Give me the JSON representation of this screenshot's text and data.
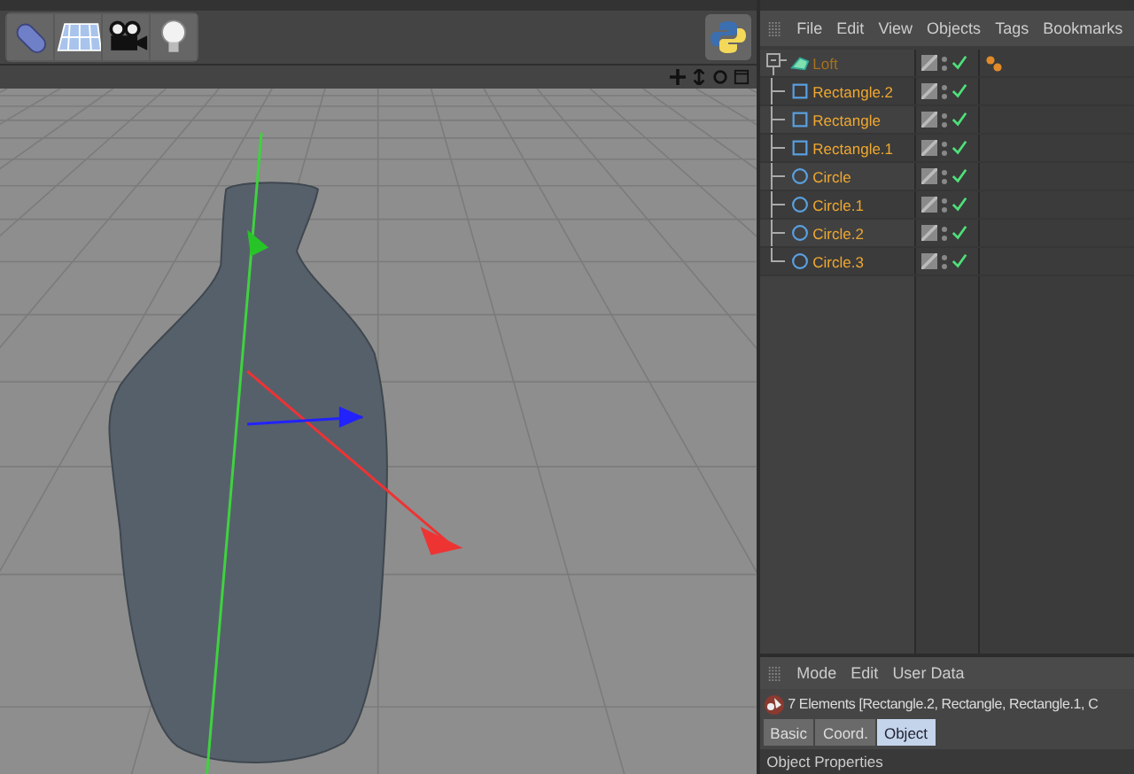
{
  "toolbar": {
    "tools": [
      {
        "kind": "capsule"
      },
      {
        "kind": "plane"
      },
      {
        "kind": "camera"
      },
      {
        "kind": "light"
      }
    ]
  },
  "object_manager": {
    "menu": [
      "File",
      "Edit",
      "View",
      "Objects",
      "Tags",
      "Bookmarks"
    ],
    "objects": [
      {
        "name": "Loft",
        "kind": "loft",
        "selected": false,
        "visible": true,
        "tag": true,
        "children": [
          {
            "name": "Rectangle.2",
            "kind": "rectangle",
            "selected": true,
            "visible": true,
            "tag": false
          },
          {
            "name": "Rectangle",
            "kind": "rectangle",
            "selected": true,
            "visible": true,
            "tag": false
          },
          {
            "name": "Rectangle.1",
            "kind": "rectangle",
            "selected": true,
            "visible": true,
            "tag": false
          },
          {
            "name": "Circle",
            "kind": "circle",
            "selected": true,
            "visible": true,
            "tag": false
          },
          {
            "name": "Circle.1",
            "kind": "circle",
            "selected": true,
            "visible": true,
            "tag": false
          },
          {
            "name": "Circle.2",
            "kind": "circle",
            "selected": true,
            "visible": true,
            "tag": false
          },
          {
            "name": "Circle.3",
            "kind": "circle",
            "selected": true,
            "visible": true,
            "tag": false
          }
        ]
      }
    ]
  },
  "attribute_manager": {
    "menu": [
      "Mode",
      "Edit",
      "User Data"
    ],
    "info": "7 Elements [Rectangle.2, Rectangle, Rectangle.1, C",
    "tabs": [
      {
        "label": "Basic",
        "selected": false
      },
      {
        "label": "Coord.",
        "selected": false
      },
      {
        "label": "Object",
        "selected": true
      }
    ],
    "section": "Object Properties"
  }
}
